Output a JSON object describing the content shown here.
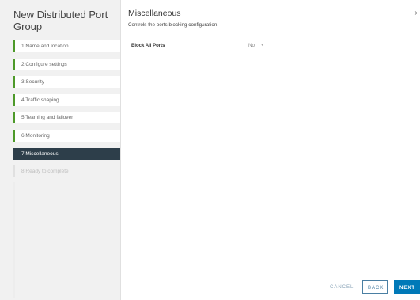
{
  "wizard": {
    "title": "New Distributed Port Group",
    "steps": [
      {
        "label": "1  Name and location",
        "state": "complete"
      },
      {
        "label": "2  Configure settings",
        "state": "complete"
      },
      {
        "label": "3  Security",
        "state": "complete"
      },
      {
        "label": "4  Traffic shaping",
        "state": "complete"
      },
      {
        "label": "5  Teaming and failover",
        "state": "complete"
      },
      {
        "label": "6  Monitoring",
        "state": "complete"
      },
      {
        "label": "7  Miscellaneous",
        "state": "active"
      },
      {
        "label": "8  Ready to complete",
        "state": "disabled"
      }
    ]
  },
  "page": {
    "title": "Miscellaneous",
    "description": "Controls the ports blocking configuration.",
    "close_icon": "close-icon"
  },
  "fields": {
    "block_all_ports_label": "Block All Ports",
    "block_all_ports_value": "No",
    "chevron_icon": "chevron-down-icon"
  },
  "footer": {
    "cancel_label": "CANCEL",
    "back_label": "BACK",
    "next_label": "NEXT"
  },
  "colors": {
    "accent": "#0079b8",
    "step_complete": "#4e9a2a",
    "step_active": "#2d3e4a"
  }
}
